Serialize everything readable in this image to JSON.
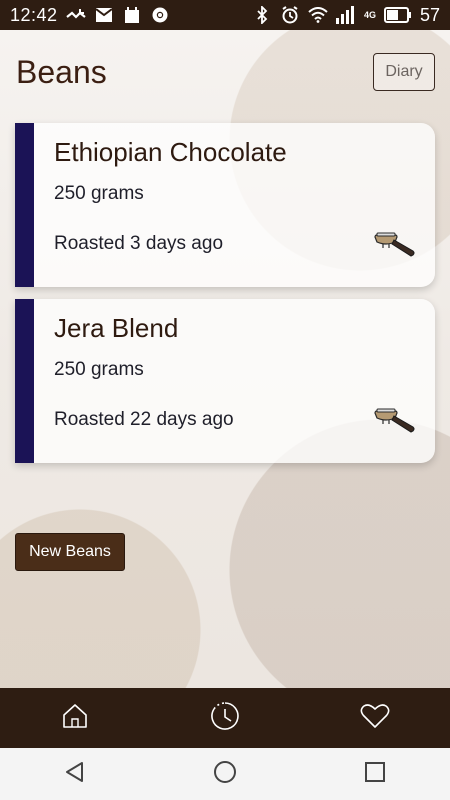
{
  "status_bar": {
    "time": "12:42",
    "battery_level": "57",
    "network_label": "4G",
    "left_icons": [
      "missed-call-icon",
      "mail-icon",
      "calendar-icon",
      "chrome-icon"
    ],
    "right_icons": [
      "bluetooth-icon",
      "alarm-icon",
      "wifi-icon",
      "signal-icon",
      "battery-icon"
    ]
  },
  "header": {
    "title": "Beans",
    "diary_label": "Diary"
  },
  "beans": [
    {
      "name": "Ethiopian Chocolate",
      "weight": "250 grams",
      "roasted": "Roasted 3 days ago",
      "icon": "portafilter-icon"
    },
    {
      "name": "Jera Blend",
      "weight": "250 grams",
      "roasted": "Roasted 22 days ago",
      "icon": "portafilter-icon"
    }
  ],
  "actions": {
    "new_beans_label": "New Beans"
  },
  "bottom_nav": {
    "items": [
      {
        "icon": "home-icon"
      },
      {
        "icon": "history-icon"
      },
      {
        "icon": "heart-icon"
      }
    ]
  },
  "system_nav": {
    "items": [
      {
        "icon": "back-icon"
      },
      {
        "icon": "home-circle-icon"
      },
      {
        "icon": "recents-icon"
      }
    ]
  },
  "colors": {
    "bar_brown": "#2e1d12",
    "accent_navy": "#1b1356",
    "button_brown": "#4a2d18",
    "title_brown": "#3b1f12"
  }
}
